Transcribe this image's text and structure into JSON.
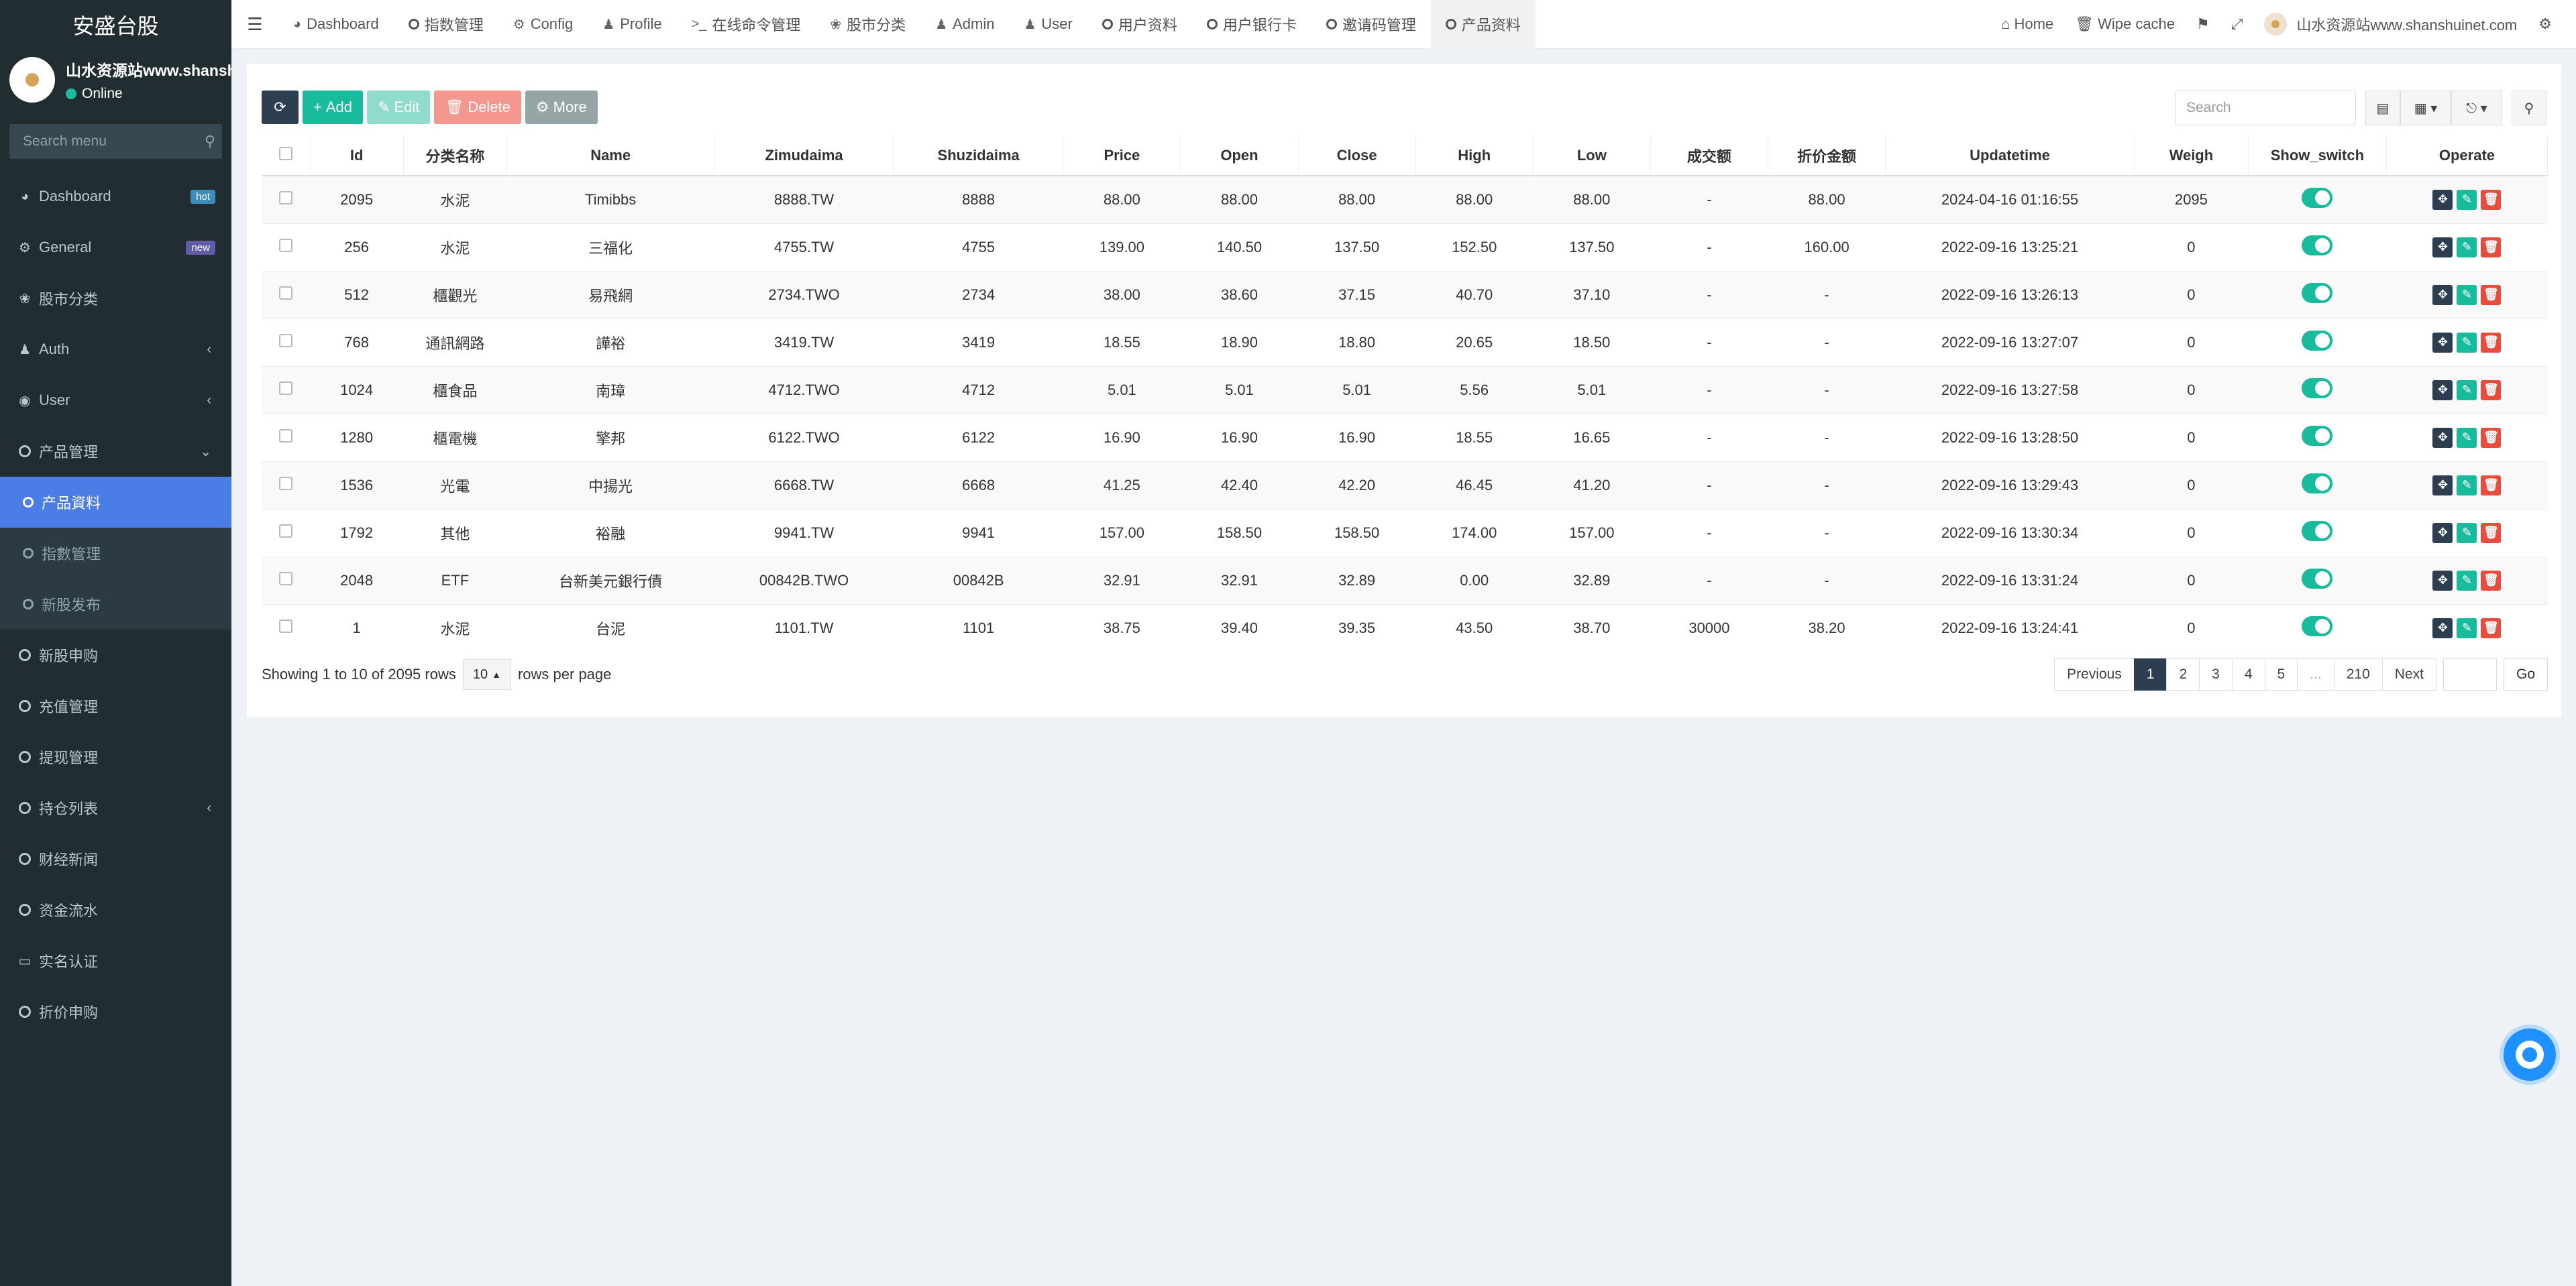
{
  "sidebar": {
    "brand": "安盛台股",
    "user_name": "山水资源站www.shanshuinet.com",
    "status": "Online",
    "search_placeholder": "Search menu",
    "items": [
      {
        "label": "Dashboard",
        "icon": "dashboard-icon",
        "badge": "hot"
      },
      {
        "label": "General",
        "icon": "cogs-icon",
        "badge": "new"
      },
      {
        "label": "股市分类",
        "icon": "leaf-icon"
      },
      {
        "label": "Auth",
        "icon": "users-icon"
      },
      {
        "label": "User",
        "icon": "user-circle-icon"
      },
      {
        "label": "产品管理",
        "icon": "circle-icon"
      }
    ],
    "submenu": [
      "产品資料",
      "指數管理",
      "新股发布"
    ],
    "items2": [
      "新股申购",
      "充值管理",
      "提现管理",
      "持仓列表",
      "财经新闻",
      "资金流水",
      "实名认证",
      "折价申购"
    ]
  },
  "topnav": {
    "tabs": [
      "Dashboard",
      "指数管理",
      "Config",
      "Profile",
      "在线命令管理",
      "股市分类",
      "Admin",
      "User",
      "用户资料",
      "用户银行卡",
      "邀请码管理",
      "产品资料"
    ],
    "home": "Home",
    "wipe_cache": "Wipe cache",
    "user": "山水资源站www.shanshuinet.com"
  },
  "toolbar": {
    "add": "Add",
    "edit": "Edit",
    "delete": "Delete",
    "more": "More",
    "search_placeholder": "Search"
  },
  "table": {
    "headers": [
      "Id",
      "分类名称",
      "Name",
      "Zimudaima",
      "Shuzidaima",
      "Price",
      "Open",
      "Close",
      "High",
      "Low",
      "成交额",
      "折价金额",
      "Updatetime",
      "Weigh",
      "Show_switch",
      "Operate"
    ],
    "rows": [
      [
        "2095",
        "水泥",
        "Timibbs",
        "8888.TW",
        "8888",
        "88.00",
        "88.00",
        "88.00",
        "88.00",
        "88.00",
        "-",
        "88.00",
        "2024-04-16 01:16:55",
        "2095"
      ],
      [
        "256",
        "水泥",
        "三福化",
        "4755.TW",
        "4755",
        "139.00",
        "140.50",
        "137.50",
        "152.50",
        "137.50",
        "-",
        "160.00",
        "2022-09-16 13:25:21",
        "0"
      ],
      [
        "512",
        "櫃觀光",
        "易飛網",
        "2734.TWO",
        "2734",
        "38.00",
        "38.60",
        "37.15",
        "40.70",
        "37.10",
        "-",
        "-",
        "2022-09-16 13:26:13",
        "0"
      ],
      [
        "768",
        "通訊網路",
        "譁裕",
        "3419.TW",
        "3419",
        "18.55",
        "18.90",
        "18.80",
        "20.65",
        "18.50",
        "-",
        "-",
        "2022-09-16 13:27:07",
        "0"
      ],
      [
        "1024",
        "櫃食品",
        "南璋",
        "4712.TWO",
        "4712",
        "5.01",
        "5.01",
        "5.01",
        "5.56",
        "5.01",
        "-",
        "-",
        "2022-09-16 13:27:58",
        "0"
      ],
      [
        "1280",
        "櫃電機",
        "擎邦",
        "6122.TWO",
        "6122",
        "16.90",
        "16.90",
        "16.90",
        "18.55",
        "16.65",
        "-",
        "-",
        "2022-09-16 13:28:50",
        "0"
      ],
      [
        "1536",
        "光電",
        "中揚光",
        "6668.TW",
        "6668",
        "41.25",
        "42.40",
        "42.20",
        "46.45",
        "41.20",
        "-",
        "-",
        "2022-09-16 13:29:43",
        "0"
      ],
      [
        "1792",
        "其他",
        "裕融",
        "9941.TW",
        "9941",
        "157.00",
        "158.50",
        "158.50",
        "174.00",
        "157.00",
        "-",
        "-",
        "2022-09-16 13:30:34",
        "0"
      ],
      [
        "2048",
        "ETF",
        "台新美元銀行債",
        "00842B.TWO",
        "00842B",
        "32.91",
        "32.91",
        "32.89",
        "0.00",
        "32.89",
        "-",
        "-",
        "2022-09-16 13:31:24",
        "0"
      ],
      [
        "1",
        "水泥",
        "台泥",
        "1101.TW",
        "1101",
        "38.75",
        "39.40",
        "39.35",
        "43.50",
        "38.70",
        "30000",
        "38.20",
        "2022-09-16 13:24:41",
        "0"
      ]
    ]
  },
  "footer": {
    "showing": "Showing 1 to 10 of 2095 rows",
    "page_size": "10",
    "rows_per_page": "rows per page",
    "pages": [
      "Previous",
      "1",
      "2",
      "3",
      "4",
      "5",
      "...",
      "210",
      "Next"
    ],
    "go": "Go"
  },
  "colors": {
    "sidebar_bg": "#222d32",
    "active": "#4a7de6",
    "add": "#18bc9c",
    "danger": "#e74c3c",
    "dark": "#2c3e50"
  }
}
